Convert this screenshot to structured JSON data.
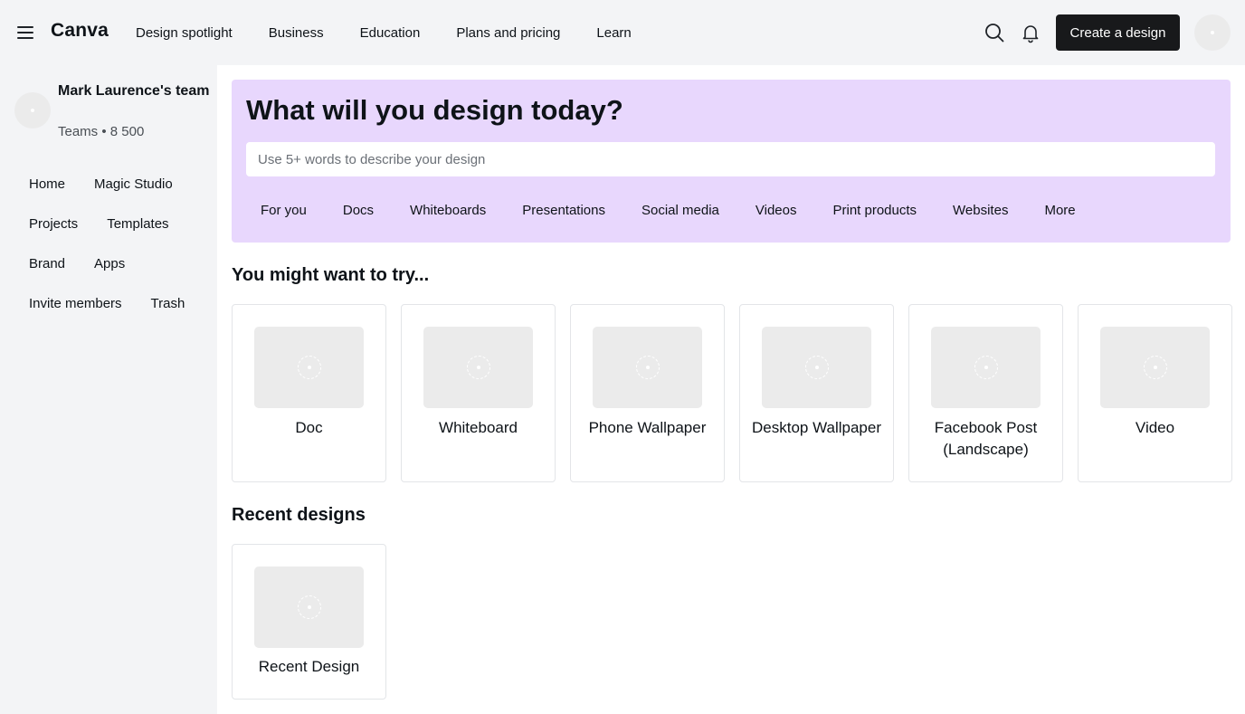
{
  "header": {
    "logo": "Canva",
    "nav": [
      "Design spotlight",
      "Business",
      "Education",
      "Plans and pricing",
      "Learn"
    ],
    "create_label": "Create a design",
    "icons": [
      "menu-icon",
      "search-icon",
      "bell-icon",
      "avatar"
    ]
  },
  "sidebar": {
    "team_name": "Mark Laurence's team",
    "team_sub": "Teams • 8 500",
    "items": [
      {
        "label": "Home"
      },
      {
        "label": "Magic Studio"
      },
      {
        "label": "Projects"
      },
      {
        "label": "Templates"
      },
      {
        "label": "Brand"
      },
      {
        "label": "Apps"
      },
      {
        "label": "Invite members"
      },
      {
        "label": "Trash"
      }
    ]
  },
  "hero": {
    "title": "What will you design today?",
    "search_placeholder": "Use 5+ words to describe your design",
    "chips": [
      "For you",
      "Docs",
      "Whiteboards",
      "Presentations",
      "Social media",
      "Videos",
      "Print products",
      "Websites",
      "More"
    ]
  },
  "suggestions": {
    "title": "You might want to try...",
    "items": [
      {
        "label": "Doc"
      },
      {
        "label": "Whiteboard"
      },
      {
        "label": "Phone Wallpaper"
      },
      {
        "label": "Desktop Wallpaper"
      },
      {
        "label": "Facebook Post (Landscape)"
      },
      {
        "label": "Video"
      }
    ]
  },
  "recent": {
    "title": "Recent designs",
    "items": [
      {
        "label": "Recent Design"
      }
    ]
  },
  "colors": {
    "hero_bg": "#e8d7fd",
    "header_bg": "#f3f4f6",
    "primary_button": "#18191b"
  }
}
